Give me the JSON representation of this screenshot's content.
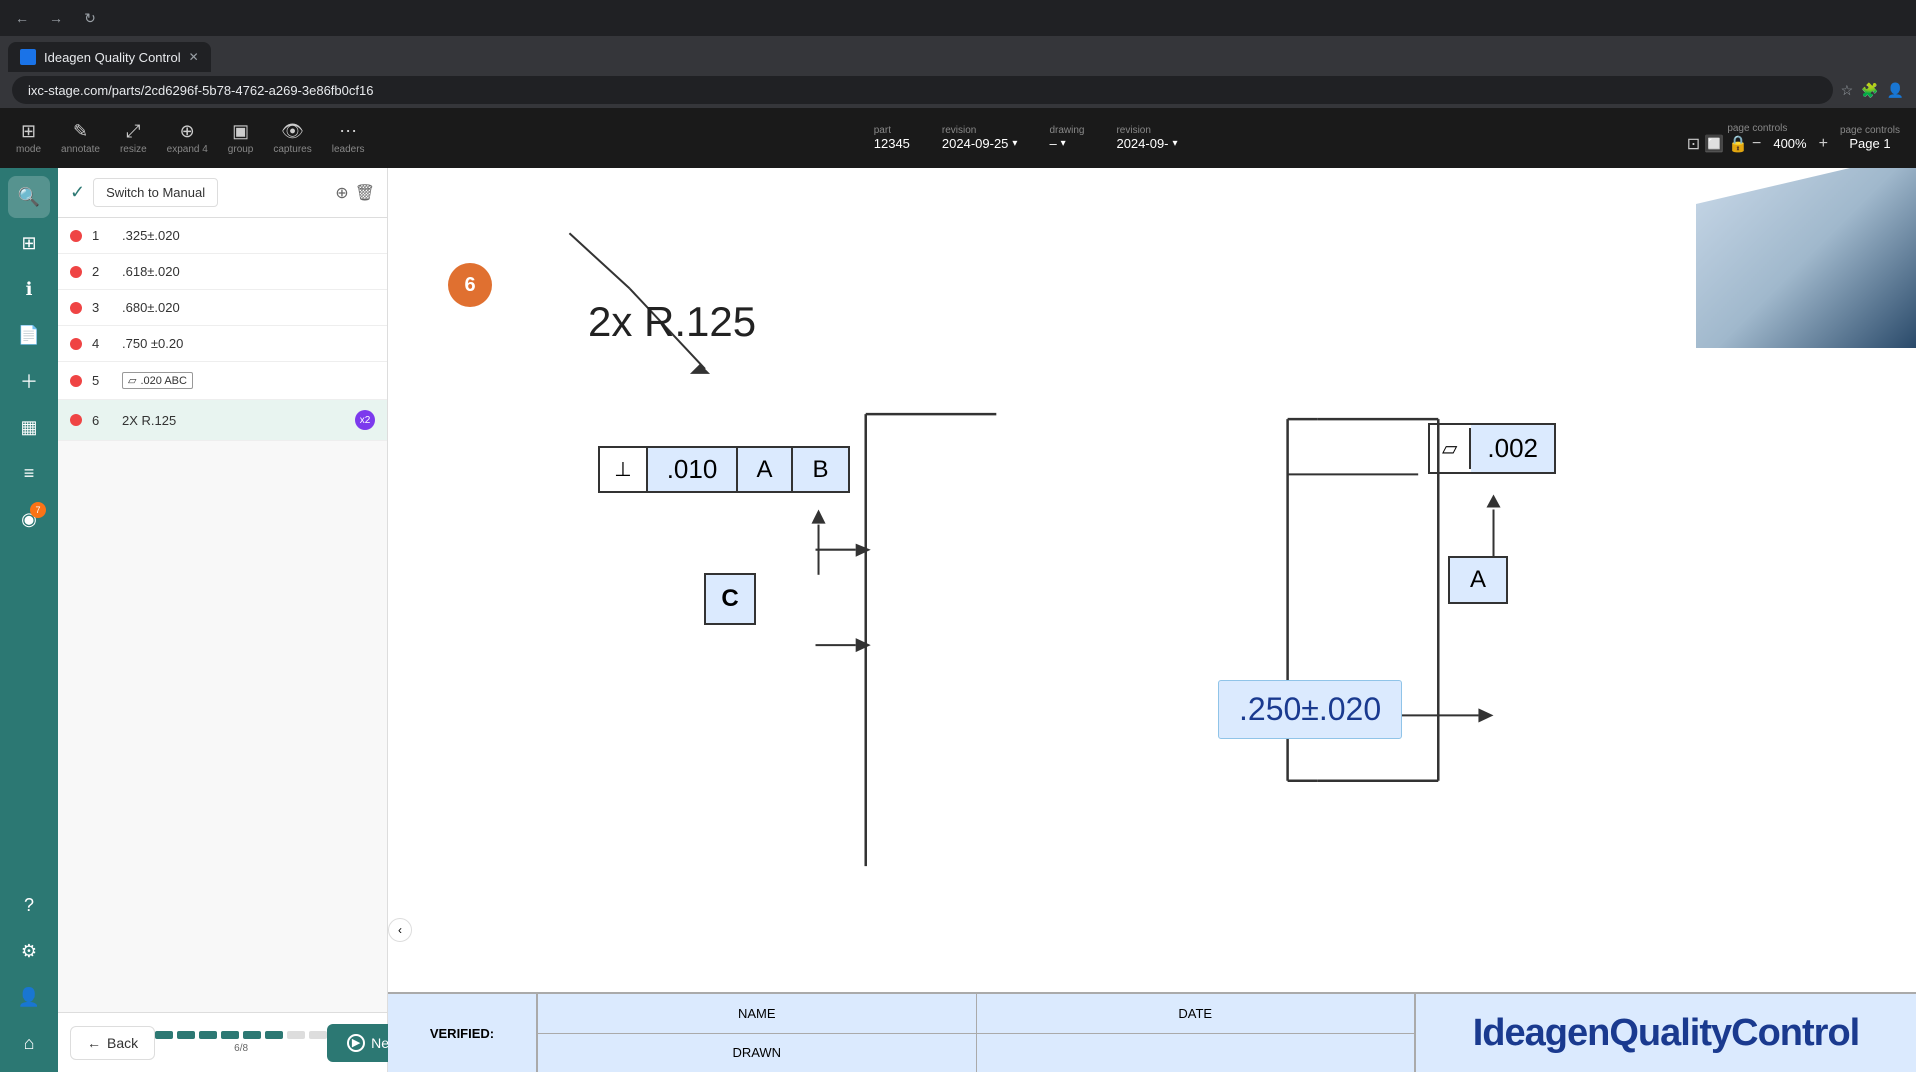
{
  "browser": {
    "tab_title": "Ideagen Quality Control",
    "url": "ixc-stage.com/parts/2cd6296f-5b78-4762-a269-3e86fb0cf16",
    "back_tooltip": "Back",
    "forward_tooltip": "Forward",
    "refresh_tooltip": "Refresh"
  },
  "toolbar": {
    "groups": [
      {
        "id": "mode",
        "label": "mode",
        "icon": "⊞"
      },
      {
        "id": "annotate",
        "label": "annotate",
        "icon": "✎"
      },
      {
        "id": "resize",
        "label": "resize",
        "icon": "⤢"
      },
      {
        "id": "expand",
        "label": "expand 4",
        "icon": "⊕"
      },
      {
        "id": "group",
        "label": "group",
        "icon": "⬛"
      },
      {
        "id": "captures",
        "label": "captures",
        "icon": "👁"
      },
      {
        "id": "leaders",
        "label": "leaders",
        "icon": "⋯"
      }
    ],
    "part_label": "part",
    "part_value": "12345",
    "revision_label": "revision",
    "revision_value": "2024-09-25",
    "drawing_label": "drawing",
    "drawing_value": "–",
    "drawing_revision_label": "revision",
    "drawing_revision_value": "2024-09-",
    "page_controls_label": "page controls",
    "zoom_value": "400%",
    "page_label": "Page 1"
  },
  "sidebar": {
    "icons": [
      {
        "id": "search",
        "icon": "🔍",
        "active": true
      },
      {
        "id": "dashboard",
        "icon": "⊞",
        "active": false
      },
      {
        "id": "info",
        "icon": "ℹ",
        "active": false
      },
      {
        "id": "document",
        "icon": "📄",
        "active": false
      },
      {
        "id": "add",
        "icon": "＋",
        "active": false
      },
      {
        "id": "table",
        "icon": "▦",
        "active": false
      },
      {
        "id": "layers",
        "icon": "≡",
        "active": false
      },
      {
        "id": "badge7",
        "icon": "◉",
        "badge": "7",
        "active": false
      },
      {
        "id": "chart",
        "icon": "📊",
        "active": false
      },
      {
        "id": "help",
        "icon": "?",
        "active": false
      },
      {
        "id": "settings",
        "icon": "⚙",
        "active": false
      },
      {
        "id": "user",
        "icon": "👤",
        "active": false
      },
      {
        "id": "home",
        "icon": "⌂",
        "active": false
      }
    ]
  },
  "inspection_panel": {
    "switch_btn_label": "Switch to Manual",
    "rows": [
      {
        "number": "1",
        "value": ".325±.020",
        "badge": null
      },
      {
        "number": "2",
        "value": ".618±.020",
        "badge": null
      },
      {
        "number": "3",
        "value": ".680±.020",
        "badge": null
      },
      {
        "number": "4",
        "value": ".750 ±0.20",
        "badge": null
      },
      {
        "number": "5",
        "value": "symbol .020 ABC",
        "badge": null,
        "has_symbol": true
      },
      {
        "number": "6",
        "value": "2X R.125",
        "badge": "x2",
        "badge_color": "#7c3aed"
      }
    ]
  },
  "drawing": {
    "balloon_number": "6",
    "annotation_label": "2x R.125",
    "fcf": {
      "symbol": "⊥",
      "tolerance": ".010",
      "datum_a": "A",
      "datum_b": "B"
    },
    "datum_c": "C",
    "datum_ref_a": "A",
    "tolerance_value": ".002",
    "dimension_value": ".250±.020"
  },
  "bottom_bar": {
    "back_label": "Back",
    "next_label": "Next",
    "progress_text": "6/8",
    "dots_filled": 6,
    "dots_total": 8
  },
  "title_block": {
    "label_verified": "VERIFIED:",
    "label_name": "NAME",
    "label_date": "DATE",
    "label_drawn": "DRAWN",
    "brand": "IdeagenQualityControl"
  }
}
